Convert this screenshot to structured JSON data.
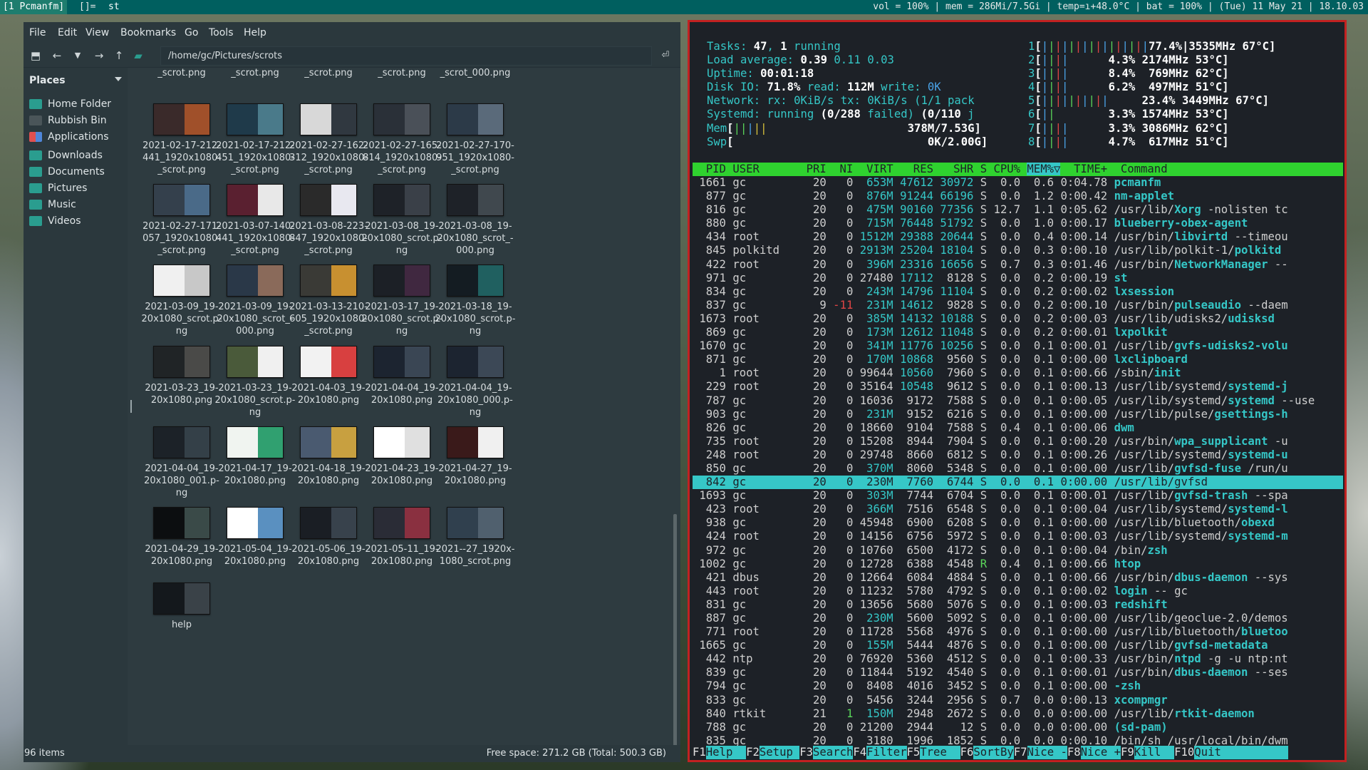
{
  "topbar": {
    "tags": [
      "[1 Pcmanfm]",
      "[]=",
      "st"
    ],
    "status": "vol = 100% | mem = 286Mi/7.5Gi | temp=ı+48.0°C | bat = 100% | (Tue) 11 May 21 | 18.10.03"
  },
  "fm": {
    "menu": [
      "File",
      "Edit",
      "View",
      "Bookmarks",
      "Go",
      "Tools",
      "Help"
    ],
    "path": "/home/gc/Pictures/scrots",
    "places_title": "Places",
    "places": [
      {
        "label": "Home Folder",
        "icon": "home-folder-icon"
      },
      {
        "label": "Rubbish Bin",
        "icon": "trash-icon"
      },
      {
        "label": "Applications",
        "icon": "applications-icon"
      },
      {
        "label": "Downloads",
        "icon": "folder-icon"
      },
      {
        "label": "Documents",
        "icon": "folder-icon"
      },
      {
        "label": "Pictures",
        "icon": "folder-icon"
      },
      {
        "label": "Music",
        "icon": "folder-icon"
      },
      {
        "label": "Videos",
        "icon": "folder-icon"
      }
    ],
    "top_names": [
      "_scrot.png",
      "_scrot.png",
      "_scrot.png",
      "_scrot.png",
      "_scrot_000.png"
    ],
    "files": [
      {
        "name": "2021-02-17-212-\n441_1920x1080-\n_scrot.png",
        "thumb": [
          "#3a2a2a",
          "#a0502a"
        ]
      },
      {
        "name": "2021-02-17-212-\n451_1920x1080-\n_scrot.png",
        "thumb": [
          "#1f3a4a",
          "#4a7a8a"
        ]
      },
      {
        "name": "2021-02-27-162-\n312_1920x1080-\n_scrot.png",
        "thumb": [
          "#d8d8d8",
          "#303840"
        ]
      },
      {
        "name": "2021-02-27-165-\n814_1920x1080-\n_scrot.png",
        "thumb": [
          "#2a3038",
          "#4a5058"
        ]
      },
      {
        "name": "2021-02-27-170-\n951_1920x1080-\n_scrot.png",
        "thumb": [
          "#2c3a48",
          "#5a6a7a"
        ]
      },
      {
        "name": "2021-02-27-171-\n057_1920x1080-\n_scrot.png",
        "thumb": [
          "#34404c",
          "#4a6a88"
        ]
      },
      {
        "name": "2021-03-07-140-\n441_1920x1080-\n_scrot.png",
        "thumb": [
          "#5a2030",
          "#e8e8e8"
        ]
      },
      {
        "name": "2021-03-08-223-\n847_1920x1080-\n_scrot.png",
        "thumb": [
          "#2a2a2a",
          "#e8e8f0"
        ]
      },
      {
        "name": "2021-03-08_19-\n20x1080_scrot.p-\nng",
        "thumb": [
          "#1e2228",
          "#3a4048"
        ]
      },
      {
        "name": "2021-03-08_19-\n20x1080_scrot_-\n000.png",
        "thumb": [
          "#1e2228",
          "#40484e"
        ]
      },
      {
        "name": "2021-03-09_19-\n20x1080_scrot.p-\nng",
        "thumb": [
          "#f0f0f0",
          "#c8c8c8"
        ]
      },
      {
        "name": "2021-03-09_19-\n20x1080_scrot_-\n000.png",
        "thumb": [
          "#2a3848",
          "#8a6a5a"
        ]
      },
      {
        "name": "2021-03-13-210-\n605_1920x1080-\n_scrot.png",
        "thumb": [
          "#3a3a36",
          "#c89030"
        ]
      },
      {
        "name": "2021-03-17_19-\n20x1080_scrot.p-\nng",
        "thumb": [
          "#1c2026",
          "#402840"
        ]
      },
      {
        "name": "2021-03-18_19-\n20x1080_scrot.p-\nng",
        "thumb": [
          "#141c22",
          "#206060"
        ]
      },
      {
        "name": "2021-03-23_19-\n20x1080.png",
        "thumb": [
          "#202426",
          "#4a4a48"
        ]
      },
      {
        "name": "2021-03-23_19-\n20x1080_scrot.p-\nng",
        "thumb": [
          "#4a5a3a",
          "#f0f0f0"
        ]
      },
      {
        "name": "2021-04-03_19-\n20x1080.png",
        "thumb": [
          "#f2f2f2",
          "#d84040"
        ]
      },
      {
        "name": "2021-04-04_19-\n20x1080.png",
        "thumb": [
          "#1c2430",
          "#3a4654"
        ]
      },
      {
        "name": "2021-04-04_19-\n20x1080_000.p-\nng",
        "thumb": [
          "#1c2430",
          "#3c4856"
        ]
      },
      {
        "name": "2021-04-04_19-\n20x1080_001.p-\nng",
        "thumb": [
          "#1c2228",
          "#344048"
        ]
      },
      {
        "name": "2021-04-17_19-\n20x1080.png",
        "thumb": [
          "#f0f4f0",
          "#30a070"
        ]
      },
      {
        "name": "2021-04-18_19-\n20x1080.png",
        "thumb": [
          "#4a5a70",
          "#c8a040"
        ]
      },
      {
        "name": "2021-04-23_19-\n20x1080.png",
        "thumb": [
          "#ffffff",
          "#e0e0e0"
        ]
      },
      {
        "name": "2021-04-27_19-\n20x1080.png",
        "thumb": [
          "#3a1a1a",
          "#f0f0f0"
        ]
      },
      {
        "name": "2021-04-29_19-\n20x1080.png",
        "thumb": [
          "#0c0e10",
          "#3a4a48"
        ]
      },
      {
        "name": "2021-05-04_19-\n20x1080.png",
        "thumb": [
          "#ffffff",
          "#5a90c0"
        ]
      },
      {
        "name": "2021-05-06_19-\n20x1080.png",
        "thumb": [
          "#1a1e24",
          "#38424c"
        ]
      },
      {
        "name": "2021-05-11_19-\n20x1080.png",
        "thumb": [
          "#2a2c36",
          "#8a3040"
        ]
      },
      {
        "name": "2021--27_1920x-\n1080_scrot.png",
        "thumb": [
          "#30404e",
          "#50606e"
        ]
      },
      {
        "name": "help",
        "thumb": [
          "#14181c",
          "#3a4248"
        ]
      }
    ],
    "status_left": "96 items",
    "status_right": "Free space: 271.2 GB (Total: 500.3 GB)"
  },
  "htop": {
    "header_lines": [
      [
        [
          "cy",
          "Tasks: "
        ],
        [
          "wb",
          "47"
        ],
        [
          "cy",
          ", "
        ],
        [
          "wb",
          "1"
        ],
        [
          "cy",
          " running"
        ]
      ],
      [
        [
          "cy",
          "Load average: "
        ],
        [
          "wb",
          "0.39 "
        ],
        [
          "cy",
          "0.11 "
        ],
        [
          "cy",
          "0.03"
        ]
      ],
      [
        [
          "cy",
          "Uptime: "
        ],
        [
          "wb",
          "00:01:18"
        ]
      ],
      [
        [
          "cy",
          "Disk IO: "
        ],
        [
          "wb",
          "71.8%"
        ],
        [
          "cy",
          " read: "
        ],
        [
          "wb",
          "112M"
        ],
        [
          "cy",
          " write: "
        ],
        [
          "bl",
          "0K"
        ]
      ],
      [
        [
          "cy",
          "Network: rx: "
        ],
        [
          "cy",
          "0KiB/s"
        ],
        [
          "cy",
          " tx: "
        ],
        [
          "cy",
          "0KiB/s"
        ],
        [
          "cy",
          " (1/1 pack"
        ]
      ],
      [
        [
          "cy",
          "Systemd: "
        ],
        [
          "cy",
          "running "
        ],
        [
          "wb",
          "(0/288 "
        ],
        [
          "cy",
          "failed) "
        ],
        [
          "wb",
          "(0/110 "
        ],
        [
          "cy",
          "j"
        ]
      ],
      [
        [
          "cy",
          "Mem"
        ],
        [
          "wb",
          "["
        ],
        [
          "gr",
          "||"
        ],
        [
          "bl",
          "|"
        ],
        [
          "yl",
          "||"
        ],
        [
          "wb",
          "                     378M/7.53G]"
        ]
      ],
      [
        [
          "cy",
          "Swp"
        ],
        [
          "wb",
          "[                             0K/2.00G]"
        ]
      ]
    ],
    "cpu_lines": [
      {
        "n": "1",
        "bar": "||||||||||||||||",
        "tail": "77.4%|3535",
        "mhz": "MHz",
        "t": "67°C]"
      },
      {
        "n": "2",
        "bar": "||||",
        "tail": "      4.3% 2174",
        "mhz": "MHz",
        "t": "53°C]"
      },
      {
        "n": "3",
        "bar": "||||",
        "tail": "      8.4%  769",
        "mhz": "MHz",
        "t": "62°C]"
      },
      {
        "n": "4",
        "bar": "||||",
        "tail": "      6.2%  497",
        "mhz": "MHz",
        "t": "51°C]"
      },
      {
        "n": "5",
        "bar": "||||||||||",
        "tail": "     23.4% 3449",
        "mhz": "MHz",
        "t": "67°C]"
      },
      {
        "n": "6",
        "bar": "||",
        "tail": "        3.3% 1574",
        "mhz": "MHz",
        "t": "53°C]"
      },
      {
        "n": "7",
        "bar": "||||",
        "tail": "      3.3% 3086",
        "mhz": "MHz",
        "t": "62°C]"
      },
      {
        "n": "8",
        "bar": "||||",
        "tail": "      4.7%  617",
        "mhz": "MHz",
        "t": "51°C]"
      }
    ],
    "columns": "  PID USER       PRI  NI  VIRT   RES   SHR S CPU% ",
    "sort_col": "MEM%▽",
    "columns_tail": "  TIME+  Command",
    "processes": [
      [
        "1661",
        "gc",
        "20",
        "0",
        "653M",
        "47612",
        "30972",
        "S",
        "0.0",
        "0.6",
        "0:04.78",
        "",
        "pcmanfm",
        ""
      ],
      [
        "877",
        "gc",
        "20",
        "0",
        "876M",
        "91244",
        "66196",
        "S",
        "0.0",
        "1.2",
        "0:00.42",
        "",
        "nm-applet",
        ""
      ],
      [
        "816",
        "gc",
        "20",
        "0",
        "475M",
        "90160",
        "77356",
        "S",
        "12.7",
        "1.1",
        "0:05.62",
        "/usr/lib/",
        "Xorg",
        " -nolisten tc"
      ],
      [
        "880",
        "gc",
        "20",
        "0",
        "715M",
        "76448",
        "51792",
        "S",
        "0.0",
        "1.0",
        "0:00.17",
        "",
        "blueberry-obex-agent",
        ""
      ],
      [
        "434",
        "root",
        "20",
        "0",
        "1512M",
        "29388",
        "20644",
        "S",
        "0.0",
        "0.4",
        "0:00.14",
        "/usr/bin/",
        "libvirtd",
        " --timeou"
      ],
      [
        "845",
        "polkitd",
        "20",
        "0",
        "2913M",
        "25204",
        "18104",
        "S",
        "0.0",
        "0.3",
        "0:00.10",
        "/usr/lib/polkit-1/",
        "polkitd",
        ""
      ],
      [
        "422",
        "root",
        "20",
        "0",
        "396M",
        "23316",
        "16656",
        "S",
        "0.7",
        "0.3",
        "0:01.46",
        "/usr/bin/",
        "NetworkManager",
        " --"
      ],
      [
        "971",
        "gc",
        "20",
        "0",
        "27480",
        "17112",
        "8128",
        "S",
        "0.0",
        "0.2",
        "0:00.19",
        "",
        "st",
        ""
      ],
      [
        "834",
        "gc",
        "20",
        "0",
        "243M",
        "14796",
        "11104",
        "S",
        "0.0",
        "0.2",
        "0:00.02",
        "",
        "lxsession",
        ""
      ],
      [
        "837",
        "gc",
        "9",
        "-11",
        "231M",
        "14612",
        "9828",
        "S",
        "0.0",
        "0.2",
        "0:00.10",
        "/usr/bin/",
        "pulseaudio",
        " --daem"
      ],
      [
        "1673",
        "root",
        "20",
        "0",
        "385M",
        "14132",
        "10188",
        "S",
        "0.0",
        "0.2",
        "0:00.03",
        "/usr/lib/udisks2/",
        "udisksd",
        ""
      ],
      [
        "869",
        "gc",
        "20",
        "0",
        "173M",
        "12612",
        "11048",
        "S",
        "0.0",
        "0.2",
        "0:00.01",
        "",
        "lxpolkit",
        ""
      ],
      [
        "1670",
        "gc",
        "20",
        "0",
        "341M",
        "11776",
        "10256",
        "S",
        "0.0",
        "0.1",
        "0:00.01",
        "/usr/lib/",
        "gvfs-udisks2-volu",
        ""
      ],
      [
        "871",
        "gc",
        "20",
        "0",
        "170M",
        "10868",
        "9560",
        "S",
        "0.0",
        "0.1",
        "0:00.00",
        "",
        "lxclipboard",
        ""
      ],
      [
        "1",
        "root",
        "20",
        "0",
        "99644",
        "10560",
        "7960",
        "S",
        "0.0",
        "0.1",
        "0:00.66",
        "/sbin/",
        "init",
        ""
      ],
      [
        "229",
        "root",
        "20",
        "0",
        "35164",
        "10548",
        "9612",
        "S",
        "0.0",
        "0.1",
        "0:00.13",
        "/usr/lib/systemd/",
        "systemd-j",
        ""
      ],
      [
        "787",
        "gc",
        "20",
        "0",
        "16036",
        "9172",
        "7588",
        "S",
        "0.0",
        "0.1",
        "0:00.05",
        "/usr/lib/systemd/",
        "systemd",
        " --use"
      ],
      [
        "903",
        "gc",
        "20",
        "0",
        "231M",
        "9152",
        "6216",
        "S",
        "0.0",
        "0.1",
        "0:00.00",
        "/usr/lib/pulse/",
        "gsettings-h",
        ""
      ],
      [
        "826",
        "gc",
        "20",
        "0",
        "18660",
        "9104",
        "7588",
        "S",
        "0.4",
        "0.1",
        "0:00.06",
        "",
        "dwm",
        ""
      ],
      [
        "735",
        "root",
        "20",
        "0",
        "15208",
        "8944",
        "7904",
        "S",
        "0.0",
        "0.1",
        "0:00.20",
        "/usr/bin/",
        "wpa_supplicant",
        " -u"
      ],
      [
        "248",
        "root",
        "20",
        "0",
        "29748",
        "8660",
        "6812",
        "S",
        "0.0",
        "0.1",
        "0:00.26",
        "/usr/lib/systemd/",
        "systemd-u",
        ""
      ],
      [
        "850",
        "gc",
        "20",
        "0",
        "370M",
        "8060",
        "5348",
        "S",
        "0.0",
        "0.1",
        "0:00.00",
        "/usr/lib/",
        "gvfsd-fuse",
        " /run/u"
      ],
      [
        "842",
        "gc",
        "20",
        "0",
        "230M",
        "7760",
        "6744",
        "S",
        "0.0",
        "0.1",
        "0:00.00",
        "/usr/lib/",
        "gvfsd",
        ""
      ],
      [
        "1693",
        "gc",
        "20",
        "0",
        "303M",
        "7744",
        "6704",
        "S",
        "0.0",
        "0.1",
        "0:00.01",
        "/usr/lib/",
        "gvfsd-trash",
        " --spa"
      ],
      [
        "423",
        "root",
        "20",
        "0",
        "366M",
        "7516",
        "6548",
        "S",
        "0.0",
        "0.1",
        "0:00.04",
        "/usr/lib/systemd/",
        "systemd-l",
        ""
      ],
      [
        "938",
        "gc",
        "20",
        "0",
        "45948",
        "6900",
        "6208",
        "S",
        "0.0",
        "0.1",
        "0:00.00",
        "/usr/lib/bluetooth/",
        "obexd",
        ""
      ],
      [
        "424",
        "root",
        "20",
        "0",
        "14156",
        "6756",
        "5972",
        "S",
        "0.0",
        "0.1",
        "0:00.03",
        "/usr/lib/systemd/",
        "systemd-m",
        ""
      ],
      [
        "972",
        "gc",
        "20",
        "0",
        "10760",
        "6500",
        "4172",
        "S",
        "0.0",
        "0.1",
        "0:00.04",
        "/bin/",
        "zsh",
        ""
      ],
      [
        "1002",
        "gc",
        "20",
        "0",
        "12728",
        "6388",
        "4548",
        "R",
        "0.4",
        "0.1",
        "0:00.66",
        "",
        "htop",
        ""
      ],
      [
        "421",
        "dbus",
        "20",
        "0",
        "12664",
        "6084",
        "4884",
        "S",
        "0.0",
        "0.1",
        "0:00.66",
        "/usr/bin/",
        "dbus-daemon",
        " --sys"
      ],
      [
        "443",
        "root",
        "20",
        "0",
        "11232",
        "5780",
        "4792",
        "S",
        "0.0",
        "0.1",
        "0:00.02",
        "",
        "login",
        " -- gc"
      ],
      [
        "831",
        "gc",
        "20",
        "0",
        "13656",
        "5680",
        "5076",
        "S",
        "0.0",
        "0.1",
        "0:00.03",
        "",
        "redshift",
        ""
      ],
      [
        "887",
        "gc",
        "20",
        "0",
        "230M",
        "5600",
        "5092",
        "S",
        "0.0",
        "0.1",
        "0:00.00",
        "/usr/lib/geoclue-2.0/demos",
        "",
        ""
      ],
      [
        "771",
        "root",
        "20",
        "0",
        "11728",
        "5568",
        "4976",
        "S",
        "0.0",
        "0.1",
        "0:00.00",
        "/usr/lib/bluetooth/",
        "bluetoo",
        ""
      ],
      [
        "1665",
        "gc",
        "20",
        "0",
        "155M",
        "5444",
        "4876",
        "S",
        "0.0",
        "0.1",
        "0:00.00",
        "/usr/lib/",
        "gvfsd-metadata",
        ""
      ],
      [
        "442",
        "ntp",
        "20",
        "0",
        "76920",
        "5360",
        "4512",
        "S",
        "0.0",
        "0.1",
        "0:00.33",
        "/usr/bin/",
        "ntpd",
        " -g -u ntp:nt"
      ],
      [
        "839",
        "gc",
        "20",
        "0",
        "11844",
        "5192",
        "4540",
        "S",
        "0.0",
        "0.1",
        "0:00.01",
        "/usr/bin/",
        "dbus-daemon",
        " --ses"
      ],
      [
        "794",
        "gc",
        "20",
        "0",
        "8408",
        "4016",
        "3452",
        "S",
        "0.0",
        "0.1",
        "0:00.00",
        "",
        "-zsh",
        ""
      ],
      [
        "833",
        "gc",
        "20",
        "0",
        "5456",
        "3244",
        "2956",
        "S",
        "0.7",
        "0.0",
        "0:00.13",
        "",
        "xcompmgr",
        ""
      ],
      [
        "840",
        "rtkit",
        "21",
        "1",
        "150M",
        "2948",
        "2672",
        "S",
        "0.0",
        "0.0",
        "0:00.00",
        "/usr/lib/",
        "rtkit-daemon",
        ""
      ],
      [
        "788",
        "gc",
        "20",
        "0",
        "21200",
        "2944",
        "12",
        "S",
        "0.0",
        "0.0",
        "0:00.00",
        "",
        "(sd-pam)",
        ""
      ],
      [
        "835",
        "gc",
        "20",
        "0",
        "3180",
        "1996",
        "1852",
        "S",
        "0.0",
        "0.0",
        "0:00.10",
        "/bin/sh /usr/local/bin/dwm",
        "",
        ""
      ]
    ],
    "highlight_pid": "842",
    "fkeys": [
      [
        "F1",
        "Help  "
      ],
      [
        "F2",
        "Setup "
      ],
      [
        "F3",
        "Search"
      ],
      [
        "F4",
        "Filter"
      ],
      [
        "F5",
        "Tree  "
      ],
      [
        "F6",
        "SortBy"
      ],
      [
        "F7",
        "Nice -"
      ],
      [
        "F8",
        "Nice +"
      ],
      [
        "F9",
        "Kill  "
      ],
      [
        "F10",
        "Quit  "
      ]
    ]
  }
}
